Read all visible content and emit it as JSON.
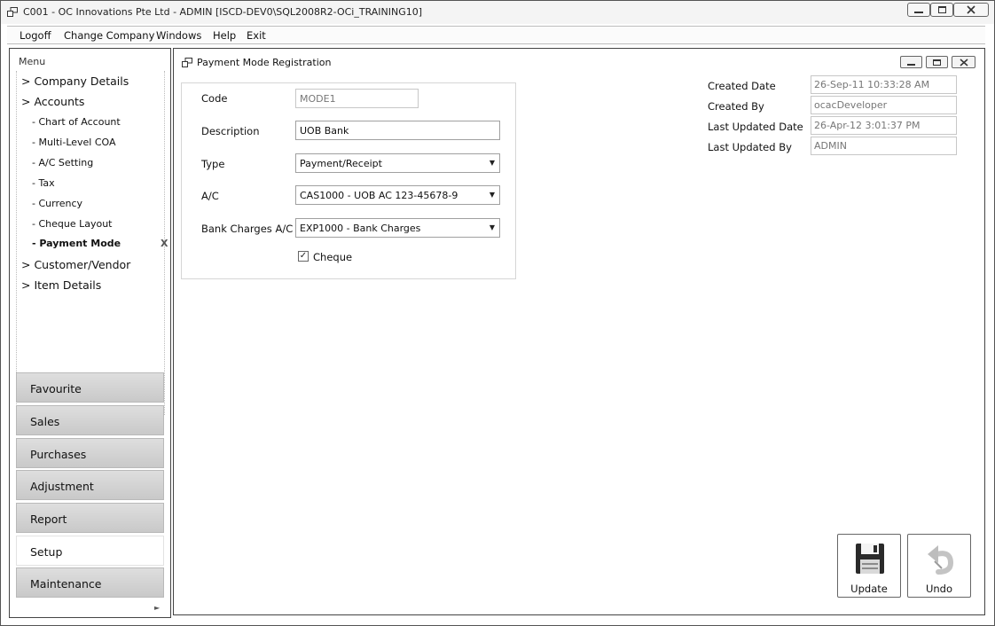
{
  "window": {
    "title": "C001 - OC Innovations Pte Ltd - ADMIN [ISCD-DEV0\\SQL2008R2-OCi_TRAINING10]",
    "controls": [
      "minimize-icon",
      "restore-icon",
      "close-icon"
    ]
  },
  "menubar": {
    "items": [
      "Logoff",
      "Change Company",
      "Windows",
      "Help",
      "Exit"
    ]
  },
  "nav": {
    "header": "Menu",
    "tree": [
      {
        "label": "> Company Details"
      },
      {
        "label": "> Accounts"
      },
      {
        "label": "- Chart of Account"
      },
      {
        "label": "- Multi-Level COA"
      },
      {
        "label": "- A/C Setting"
      },
      {
        "label": "- Tax"
      },
      {
        "label": "- Currency"
      },
      {
        "label": "- Cheque Layout"
      },
      {
        "label": "- Payment Mode"
      },
      {
        "label": "> Customer/Vendor"
      },
      {
        "label": "> Item Details"
      }
    ],
    "close_mark": "X",
    "buttons": [
      "Favourite",
      "Sales",
      "Purchases",
      "Adjustment",
      "Report",
      "Setup",
      "Maintenance"
    ],
    "active_button": "Setup"
  },
  "document": {
    "title": "Payment Mode Registration",
    "form": {
      "code_label": "Code",
      "code_value": "MODE1",
      "description_label": "Description",
      "description_value": "UOB Bank",
      "type_label": "Type",
      "type_value": "Payment/Receipt",
      "ac_label": "A/C",
      "ac_value": "CAS1000 - UOB AC 123-45678-9",
      "bank_charges_label": "Bank Charges A/C",
      "bank_charges_value": "EXP1000 - Bank Charges",
      "cheque_label": "Cheque",
      "cheque_checked": true,
      "check_mark": "✓",
      "dropdown_arrow": "▼"
    },
    "audit": {
      "created_date_label": "Created Date",
      "created_date_value": "26-Sep-11 10:33:28 AM",
      "created_by_label": "Created By",
      "created_by_value": "ocacDeveloper",
      "last_updated_date_label": "Last Updated Date",
      "last_updated_date_value": "26-Apr-12 3:01:37 PM",
      "last_updated_by_label": "Last Updated By",
      "last_updated_by_value": "ADMIN"
    },
    "actions": {
      "update_label": "Update",
      "undo_label": "Undo"
    }
  }
}
